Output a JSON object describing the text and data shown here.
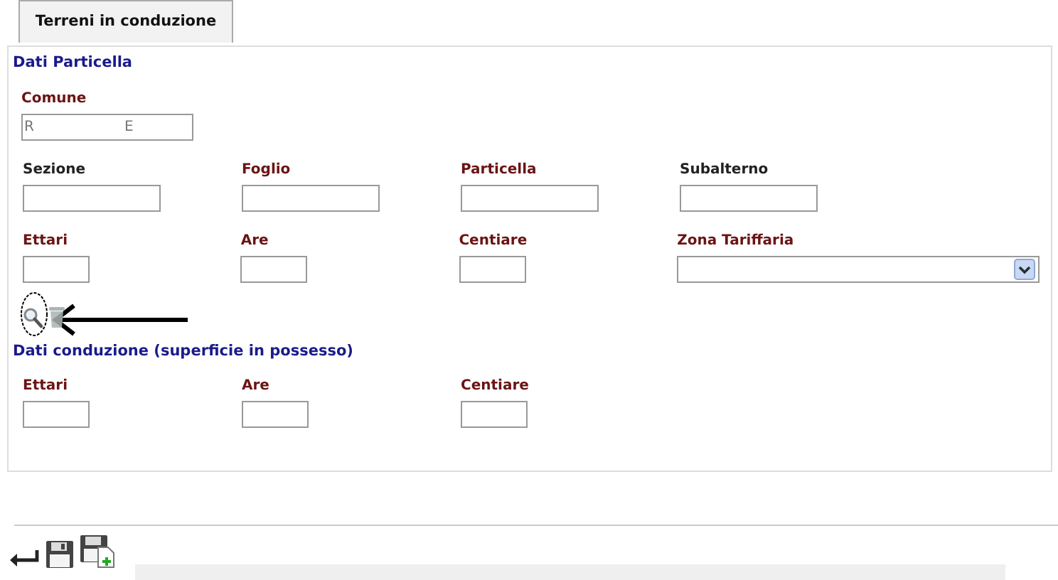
{
  "tabs": [
    {
      "label": "Terreni in conduzione",
      "selected": true
    }
  ],
  "sections": [
    {
      "title": "Dati Particella",
      "rows": [
        [
          {
            "label": "Comune",
            "required": true,
            "kind": "text",
            "value": "R                    E"
          }
        ],
        [
          {
            "label": "Sezione",
            "required": false,
            "kind": "text"
          },
          {
            "label": "Foglio",
            "required": true,
            "kind": "text"
          },
          {
            "label": "Particella",
            "required": true,
            "kind": "text"
          },
          {
            "label": "Subalterno",
            "required": false,
            "kind": "text"
          }
        ],
        [
          {
            "label": "Ettari",
            "required": true,
            "kind": "text"
          },
          {
            "label": "Are",
            "required": true,
            "kind": "text"
          },
          {
            "label": "Centiare",
            "required": true,
            "kind": "text"
          },
          {
            "label": "Zona Tariffaria",
            "required": true,
            "kind": "select"
          }
        ]
      ],
      "actions": [
        {
          "kind": "search",
          "highlighted": true
        },
        {
          "kind": "delete",
          "highlighted": false
        }
      ]
    },
    {
      "title": "Dati conduzione (superficie in possesso)",
      "rows": [
        [
          {
            "label": "Ettari",
            "required": true,
            "kind": "text"
          },
          {
            "label": "Are",
            "required": true,
            "kind": "text"
          },
          {
            "label": "Centiare",
            "required": true,
            "kind": "text"
          }
        ]
      ]
    }
  ],
  "toolbar": [
    {
      "kind": "back"
    },
    {
      "kind": "save"
    },
    {
      "kind": "save-new"
    }
  ]
}
